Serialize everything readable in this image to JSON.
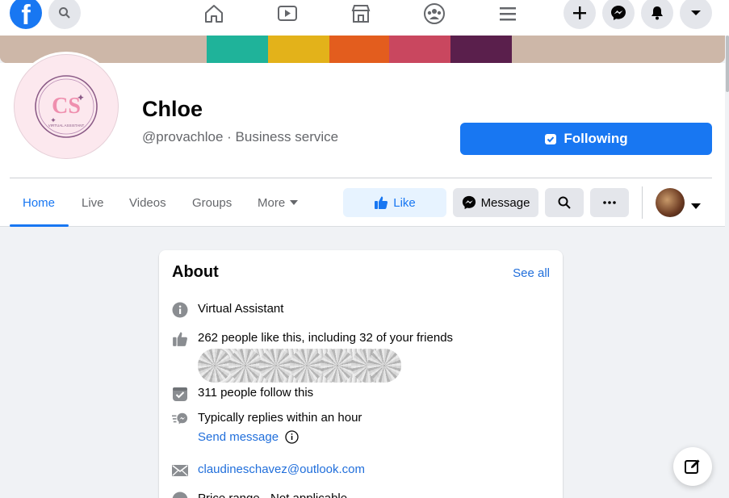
{
  "topnav": {
    "logo": "f",
    "icons": [
      "search-icon",
      "home-icon",
      "watch-icon",
      "marketplace-icon",
      "groups-icon",
      "menu-icon",
      "plus-icon",
      "messenger-icon",
      "notifications-icon",
      "account-caret-icon"
    ]
  },
  "page": {
    "name": "Chloe",
    "subtitle": "@provachloe · Business service",
    "avatar_text": "CS",
    "avatar_caption": "VIRTUAL ASSISTANT",
    "following_label": "Following"
  },
  "tabs": [
    {
      "label": "Home",
      "active": true
    },
    {
      "label": "Live"
    },
    {
      "label": "Videos"
    },
    {
      "label": "Groups"
    },
    {
      "label": "More"
    }
  ],
  "actions": {
    "like": "Like",
    "message": "Message"
  },
  "about": {
    "title": "About",
    "see_all": "See all",
    "category": "Virtual Assistant",
    "likes": "262 people like this, including 32 of your friends",
    "follows": "311 people follow this",
    "replies": "Typically replies within an hour",
    "send_message": "Send message",
    "email": "claudineschavez@outlook.com",
    "price_range": "Price range · Not applicable"
  },
  "colors": {
    "brand": "#1877f2",
    "cover_stripes": [
      "#cdb7a8",
      "#1fb39a",
      "#e3b21a",
      "#e35d1e",
      "#c9475f",
      "#5a1f4c",
      "#cdb7a8"
    ]
  }
}
